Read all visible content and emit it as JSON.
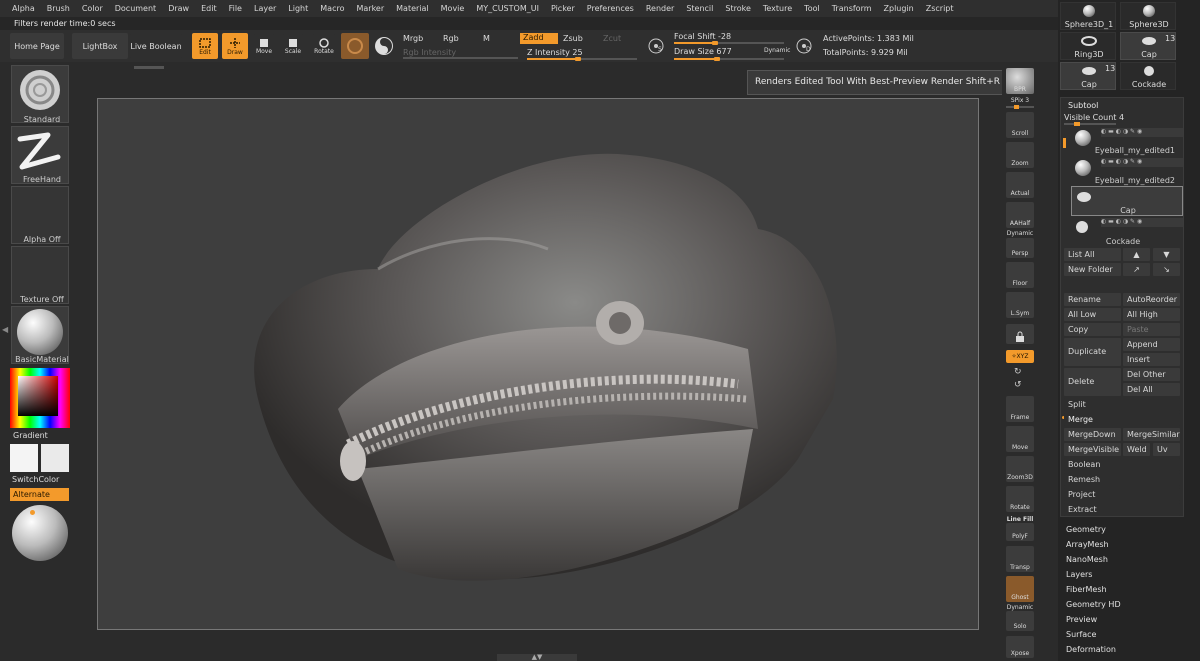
{
  "menu": [
    "Alpha",
    "Brush",
    "Color",
    "Document",
    "Draw",
    "Edit",
    "File",
    "Layer",
    "Light",
    "Macro",
    "Marker",
    "Material",
    "Movie",
    "MY_CUSTOM_UI",
    "Picker",
    "Preferences",
    "Render",
    "Stencil",
    "Stroke",
    "Texture",
    "Tool",
    "Transform",
    "Zplugin",
    "Zscript"
  ],
  "status": "Filters render time:0 secs",
  "toolbar": {
    "home_page": "Home Page",
    "lightbox": "LightBox",
    "live_boolean": "Live Boolean",
    "edit": "Edit",
    "draw": "Draw",
    "move": "Move",
    "scale": "Scale",
    "rotate": "Rotate",
    "mrgb": "Mrgb",
    "rgb": "Rgb",
    "m": "M",
    "rgb_intensity": "Rgb Intensity",
    "zadd": "Zadd",
    "zsub": "Zsub",
    "zcut": "Zcut",
    "z_intensity_label": "Z Intensity",
    "z_intensity_value": "25",
    "focal_shift_label": "Focal Shift",
    "focal_shift_value": "-28",
    "draw_size_label": "Draw Size",
    "draw_size_value": "677",
    "dynamic": "Dynamic",
    "active_points": "ActivePoints: 1.383 Mil",
    "total_points": "TotalPoints: 9.929 Mil",
    "s_icon_letter": "S",
    "d_icon_letter": "D"
  },
  "left_shelf": {
    "standard": "Standard",
    "freehand": "FreeHand",
    "alpha_off": "Alpha Off",
    "texture_off": "Texture Off",
    "basic_material": "BasicMaterial",
    "gradient": "Gradient",
    "switch_color": "SwitchColor",
    "alternate": "Alternate"
  },
  "tooltip": "Renders Edited Tool With Best-Preview Render  Shift+R",
  "right_shelf": {
    "bpr": "BPR",
    "spix": "SPix 3",
    "scroll": "Scroll",
    "zoom": "Zoom",
    "actual": "Actual",
    "aahalf": "AAHalf",
    "dynamic": "Dynamic",
    "persp": "Persp",
    "floor": "Floor",
    "lsym": "L.Sym",
    "xyz": "✧XYZ",
    "frame": "Frame",
    "move": "Move",
    "zoom3d": "Zoom3D",
    "rotate": "Rotate",
    "line_fill": "Line Fill",
    "polyf": "PolyF",
    "transp": "Transp",
    "ghost": "Ghost",
    "dynamic2": "Dynamic",
    "solo": "Solo",
    "xpose": "Xpose"
  },
  "tools": {
    "sphere3d_1": "Sphere3D_1",
    "sphere3d": "Sphere3D",
    "ring3d": "Ring3D",
    "cap": "Cap",
    "cap_count": "13",
    "cap2": "Cap",
    "cap2_count": "13",
    "cockade": "Cockade"
  },
  "subtool": {
    "title": "Subtool",
    "visible_count": "Visible Count 4",
    "items": [
      "Eyeball_my_edited1",
      "Eyeball_my_edited2",
      "Cap",
      "Cockade"
    ],
    "list_all": "List All",
    "new_folder": "New Folder",
    "rename": "Rename",
    "auto_reorder": "AutoReorder",
    "all_low": "All Low",
    "all_high": "All High",
    "copy": "Copy",
    "paste": "Paste",
    "duplicate": "Duplicate",
    "append": "Append",
    "insert": "Insert",
    "delete": "Delete",
    "del_other": "Del Other",
    "del_all": "Del All",
    "split": "Split",
    "merge": "Merge",
    "merge_down": "MergeDown",
    "merge_similar": "MergeSimilar",
    "merge_visible": "MergeVisible",
    "weld": "Weld",
    "uv": "Uv",
    "boolean": "Boolean",
    "remesh": "Remesh",
    "project": "Project",
    "extract": "Extract"
  },
  "panels": [
    "Geometry",
    "ArrayMesh",
    "NanoMesh",
    "Layers",
    "FiberMesh",
    "Geometry HD",
    "Preview",
    "Surface",
    "Deformation"
  ],
  "colors": {
    "accent": "#f39a2b"
  }
}
